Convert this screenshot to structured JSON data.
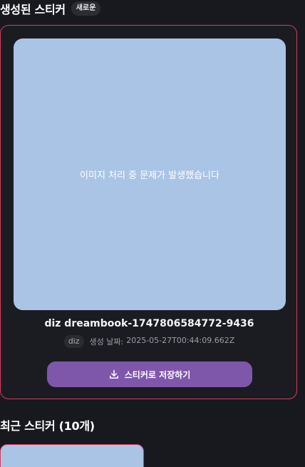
{
  "generated": {
    "title": "생성된 스티커",
    "badge": "새로운"
  },
  "sticker": {
    "error_message": "이미지 처리 중 문제가 발생했습니다",
    "name": "diz dreambook-1747806584772-9436",
    "user_tag": "diz",
    "date_label": "생성 날짜:",
    "date_value": "2025-05-27T00:44:09.662Z",
    "save_label": "스티커로 저장하기",
    "save_icon": "download-icon"
  },
  "recent": {
    "title": "최근 스티커 (10개)"
  },
  "colors": {
    "background": "#18191e",
    "accent_border": "#d63a5e",
    "image_placeholder": "#a9c4e5",
    "button": "#7e57ab"
  }
}
